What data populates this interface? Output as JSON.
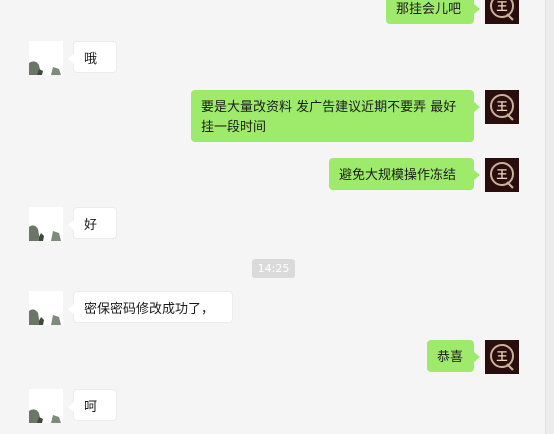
{
  "colors": {
    "background": "#f5f5f5",
    "my_bubble": "#9eea6a",
    "their_bubble": "#ffffff",
    "timestamp_bg": "#dadada",
    "my_avatar_bg": "#2a0d0d",
    "my_avatar_ring": "#c9b49a"
  },
  "my_avatar": {
    "icon": "q-wang-logo-icon",
    "glyph": "王"
  },
  "contact_avatar": {
    "icon": "contact-avatar-photo"
  },
  "messages": [
    {
      "sender": "me",
      "text": "那挂会儿吧"
    },
    {
      "sender": "contact",
      "text": "哦"
    },
    {
      "sender": "me",
      "text": "要是大量改资料 发广告建议近期不要弄  最好挂一段时间"
    },
    {
      "sender": "me",
      "text": "避免大规模操作冻结"
    },
    {
      "sender": "contact",
      "text": "好"
    },
    {
      "sender": "contact",
      "text": "密保密码修改成功了，"
    },
    {
      "sender": "me",
      "text": "恭喜"
    },
    {
      "sender": "contact",
      "text": "呵"
    }
  ],
  "timestamp": "14:25"
}
